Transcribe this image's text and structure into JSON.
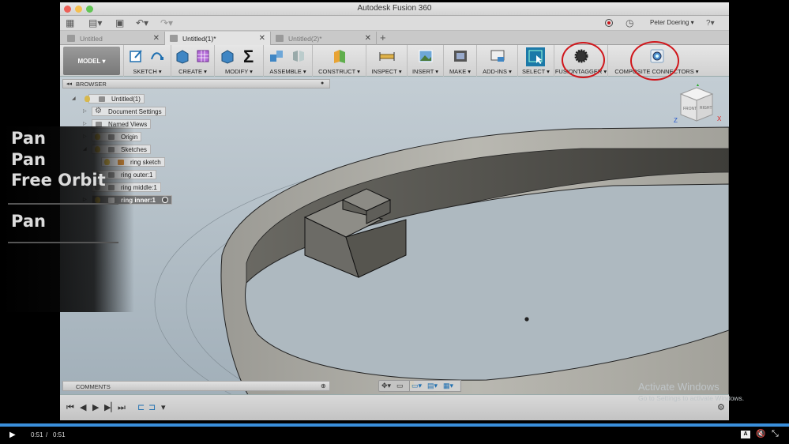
{
  "app": {
    "title": "Autodesk Fusion 360",
    "user": "Peter Doering",
    "help_label": "?"
  },
  "tabs": [
    {
      "label": "Untitled",
      "active": false
    },
    {
      "label": "Untitled(1)*",
      "active": true
    },
    {
      "label": "Untitled(2)*",
      "active": false
    }
  ],
  "toolbar": {
    "workspace": "MODEL",
    "groups": [
      {
        "label": "SKETCH"
      },
      {
        "label": "CREATE"
      },
      {
        "label": "MODIFY"
      },
      {
        "label": "ASSEMBLE"
      },
      {
        "label": "CONSTRUCT"
      },
      {
        "label": "INSPECT"
      },
      {
        "label": "INSERT"
      },
      {
        "label": "MAKE"
      },
      {
        "label": "ADD-INS"
      },
      {
        "label": "SELECT"
      },
      {
        "label": "FUSIONTAGGER"
      },
      {
        "label": "COMPOSITE CONNECTORS"
      }
    ],
    "highlight_color": "#d0161b"
  },
  "browser": {
    "title": "BROWSER",
    "nodes": [
      {
        "label": "Untitled(1)"
      },
      {
        "label": "Document Settings"
      },
      {
        "label": "Named Views"
      },
      {
        "label": "Origin"
      },
      {
        "label": "Sketches"
      },
      {
        "label": "ring sketch"
      },
      {
        "label": "ring outer:1"
      },
      {
        "label": "ring middle:1"
      },
      {
        "label": "ring inner:1"
      }
    ]
  },
  "viewcube": {
    "front": "FRONT",
    "right": "RIGHT",
    "axis_x": "X",
    "axis_z": "Z"
  },
  "comments": {
    "label": "COMMENTS"
  },
  "overlay": {
    "shortcuts": [
      "Pan",
      "Pan",
      "Free Orbit",
      "Pan"
    ]
  },
  "watermark": {
    "line1": "Activate Windows",
    "line2": "Go to Settings to activate Windows."
  },
  "player": {
    "current_time": "0:51",
    "separator": "/",
    "duration": "0:51",
    "progress": 1.0
  }
}
